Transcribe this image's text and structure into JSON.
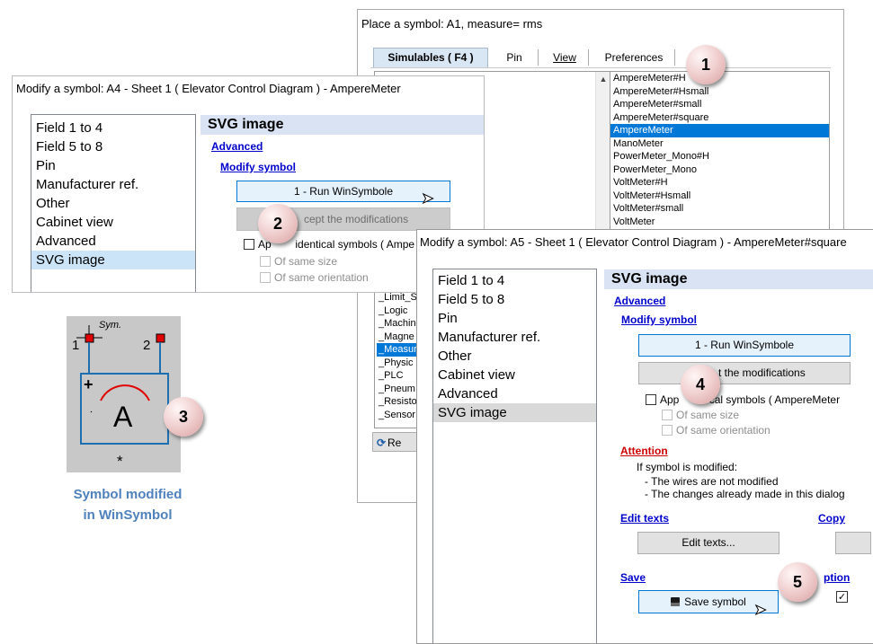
{
  "place_dialog": {
    "title": "Place a symbol:  A1, measure= rms",
    "tabs": [
      "Simulables ( F4 )",
      "Pin",
      "View",
      "Preferences"
    ],
    "tree_items": [
      "_Limit_S",
      "_Logic",
      "_Machin",
      "_Magne",
      "_Measur",
      "_Physic",
      "_PLC",
      "_Pneum",
      "_Resisto",
      "_Sensor"
    ],
    "tree_selected_index": 4,
    "symbols": [
      "AmpereMeter#H",
      "AmpereMeter#Hsmall",
      "AmpereMeter#small",
      "AmpereMeter#square",
      "AmpereMeter",
      "ManoMeter",
      "PowerMeter_Mono#H",
      "PowerMeter_Mono",
      "VoltMeter#H",
      "VoltMeter#Hsmall",
      "VoltMeter#small",
      "VoltMeter"
    ],
    "symbols_selected_index": 4,
    "refresh_label": "Re"
  },
  "dialog_a4": {
    "title": "Modify a symbol: A4 - Sheet 1 ( Elevator Control Diagram ) - AmpereMeter",
    "categories": [
      "Field 1 to 4",
      "Field 5 to 8",
      "Pin",
      "Manufacturer ref.",
      "Other",
      "Cabinet view",
      "Advanced",
      "SVG image"
    ],
    "selected_index": 7,
    "header": "SVG image",
    "advanced_link": "Advanced",
    "modify_link": "Modify symbol",
    "run_button": "1 - Run WinSymbole",
    "accept_button": "cept the modifications",
    "apply_label": "Ap        identical symbols ( Ampe",
    "same_size_label": "Of same size",
    "same_orientation_label": "Of same orientation"
  },
  "dialog_a5": {
    "title": "Modify a symbol: A5 - Sheet 1 ( Elevator Control Diagram ) - AmpereMeter#square",
    "categories": [
      "Field 1 to 4",
      "Field 5 to 8",
      "Pin",
      "Manufacturer ref.",
      "Other",
      "Cabinet view",
      "Advanced",
      "SVG image"
    ],
    "selected_index": 7,
    "header": "SVG image",
    "advanced_link": "Advanced",
    "modify_link": "Modify symbol",
    "run_button": "1 - Run WinSymbole",
    "accept_button": "t the modifications",
    "apply_label": "App          cal symbols ( AmpereMeter",
    "same_size_label": "Of same size",
    "same_orientation_label": "Of same orientation",
    "attention_label": "Attention",
    "attention_text": "If symbol is modified:",
    "attention_items": [
      "- The wires are not modified",
      "- The changes already made in this dialog"
    ],
    "edit_texts_link": "Edit texts",
    "copy_link": "Copy",
    "edit_texts_button": "Edit texts...",
    "save_link": "Save",
    "options_link": "ption",
    "save_button": "Save symbol"
  },
  "symbol_preview": {
    "sym_label": "Sym.",
    "pin1": "1",
    "pin2": "2",
    "plus": "+",
    "letter": "A",
    "star": "*",
    "caption_line1": "Symbol modified",
    "caption_line2": "in WinSymbol"
  },
  "callouts": [
    "1",
    "2",
    "3",
    "4",
    "5"
  ],
  "colors": {
    "selection_blue": "#0078d7",
    "link_blue": "#0000cc",
    "attention_red": "#cc0000",
    "caption_blue": "#4f81bd",
    "header_bg": "#dae3f3",
    "pin_red": "#e00000",
    "symbol_blue": "#1e6fb0"
  }
}
